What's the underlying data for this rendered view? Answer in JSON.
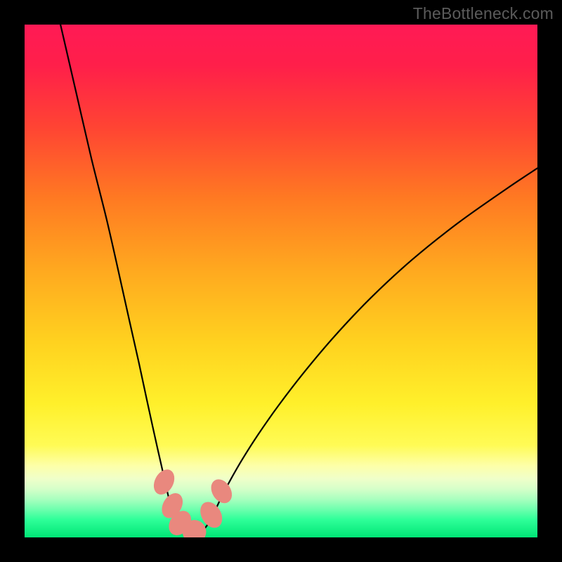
{
  "watermark": "TheBottleneck.com",
  "chart_data": {
    "type": "line",
    "title": "",
    "xlabel": "",
    "ylabel": "",
    "xlim": [
      0,
      100
    ],
    "ylim": [
      0,
      100
    ],
    "background_gradient": {
      "stops": [
        {
          "offset": 0.0,
          "color": "#ff1a55"
        },
        {
          "offset": 0.08,
          "color": "#ff1f4a"
        },
        {
          "offset": 0.2,
          "color": "#ff4433"
        },
        {
          "offset": 0.34,
          "color": "#ff7a22"
        },
        {
          "offset": 0.48,
          "color": "#ffa91f"
        },
        {
          "offset": 0.62,
          "color": "#ffd21f"
        },
        {
          "offset": 0.74,
          "color": "#fff02b"
        },
        {
          "offset": 0.82,
          "color": "#fffb55"
        },
        {
          "offset": 0.86,
          "color": "#fdffa8"
        },
        {
          "offset": 0.885,
          "color": "#f0ffc9"
        },
        {
          "offset": 0.905,
          "color": "#d6ffc9"
        },
        {
          "offset": 0.925,
          "color": "#aaffbf"
        },
        {
          "offset": 0.945,
          "color": "#6fffae"
        },
        {
          "offset": 0.965,
          "color": "#2fff99"
        },
        {
          "offset": 1.0,
          "color": "#00e676"
        }
      ]
    },
    "series": [
      {
        "name": "left-curve",
        "type": "line",
        "x": [
          7,
          10,
          13,
          16,
          18.5,
          20.5,
          22.3,
          23.8,
          25,
          26,
          26.8,
          27.4,
          27.9,
          28.3,
          28.7,
          29.2,
          29.85,
          30.7,
          31.6
        ],
        "y": [
          100,
          87,
          74,
          62,
          51,
          42,
          34,
          27,
          21.5,
          17,
          13.5,
          10.8,
          8.6,
          7,
          5.7,
          4.3,
          3,
          1.8,
          1.1
        ]
      },
      {
        "name": "right-curve",
        "type": "line",
        "x": [
          34.6,
          35.4,
          36.3,
          36.9,
          37.6,
          38.7,
          40.3,
          42.5,
          45.5,
          49.5,
          54.5,
          60.5,
          67.5,
          75.5,
          84.5,
          94,
          100
        ],
        "y": [
          1.1,
          2.1,
          3.4,
          4.6,
          6.2,
          8.5,
          11.5,
          15.3,
          20,
          25.7,
          32.2,
          39.3,
          46.7,
          54.1,
          61.3,
          68,
          72
        ]
      },
      {
        "name": "trough-floor",
        "type": "line",
        "x": [
          31.6,
          32.1,
          32.7,
          33.4,
          34.0,
          34.6
        ],
        "y": [
          1.1,
          0.6,
          0.4,
          0.4,
          0.6,
          1.1
        ]
      }
    ],
    "markers": {
      "name": "bottleneck-markers",
      "color": "#e9887e",
      "points": [
        {
          "cx": 27.2,
          "cy": 10.8,
          "rx": 1.8,
          "ry": 2.6,
          "rot": 28
        },
        {
          "cx": 28.8,
          "cy": 6.2,
          "rx": 1.8,
          "ry": 2.6,
          "rot": 30
        },
        {
          "cx": 30.3,
          "cy": 2.8,
          "rx": 1.9,
          "ry": 2.6,
          "rot": 36
        },
        {
          "cx": 33.1,
          "cy": 1.1,
          "rx": 2.3,
          "ry": 2.3,
          "rot": 85
        },
        {
          "cx": 36.4,
          "cy": 4.4,
          "rx": 1.9,
          "ry": 2.7,
          "rot": -30
        },
        {
          "cx": 38.4,
          "cy": 9.0,
          "rx": 1.8,
          "ry": 2.5,
          "rot": -32
        }
      ]
    }
  }
}
